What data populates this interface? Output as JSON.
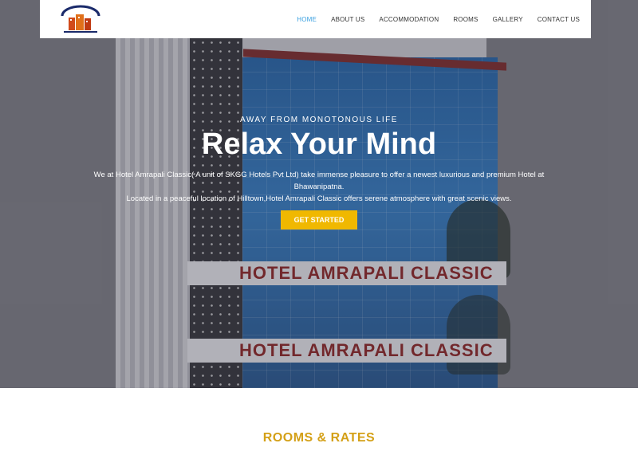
{
  "nav": {
    "logo_alt": "HOTEL AMRAPALI CLASSIC",
    "items": [
      {
        "label": "HOME",
        "active": true
      },
      {
        "label": "ABOUT US"
      },
      {
        "label": "ACCOMMODATION"
      },
      {
        "label": "ROOMS"
      },
      {
        "label": "GALLERY"
      },
      {
        "label": "CONTACT US"
      }
    ]
  },
  "hero": {
    "building_sign": "HOTEL AMRAPALI CLASSIC",
    "eyebrow": "AWAY FROM MONOTONOUS LIFE",
    "title": "Relax Your Mind",
    "description_line1": "We at Hotel Amrapali Classic( A unit of SKGG Hotels Pvt Ltd) take immense pleasure to offer a newest luxurious and premium Hotel at Bhawanipatna.",
    "description_line2": "Located in a peaceful location of Hilltown,Hotel Amrapali Classic offers serene atmosphere with great scenic views.",
    "cta_label": "GET STARTED"
  },
  "rooms": {
    "title": "ROOMS & RATES"
  },
  "colors": {
    "accent": "#f0b800",
    "nav_active": "#3aa0e0",
    "section_title": "#d4a017"
  }
}
